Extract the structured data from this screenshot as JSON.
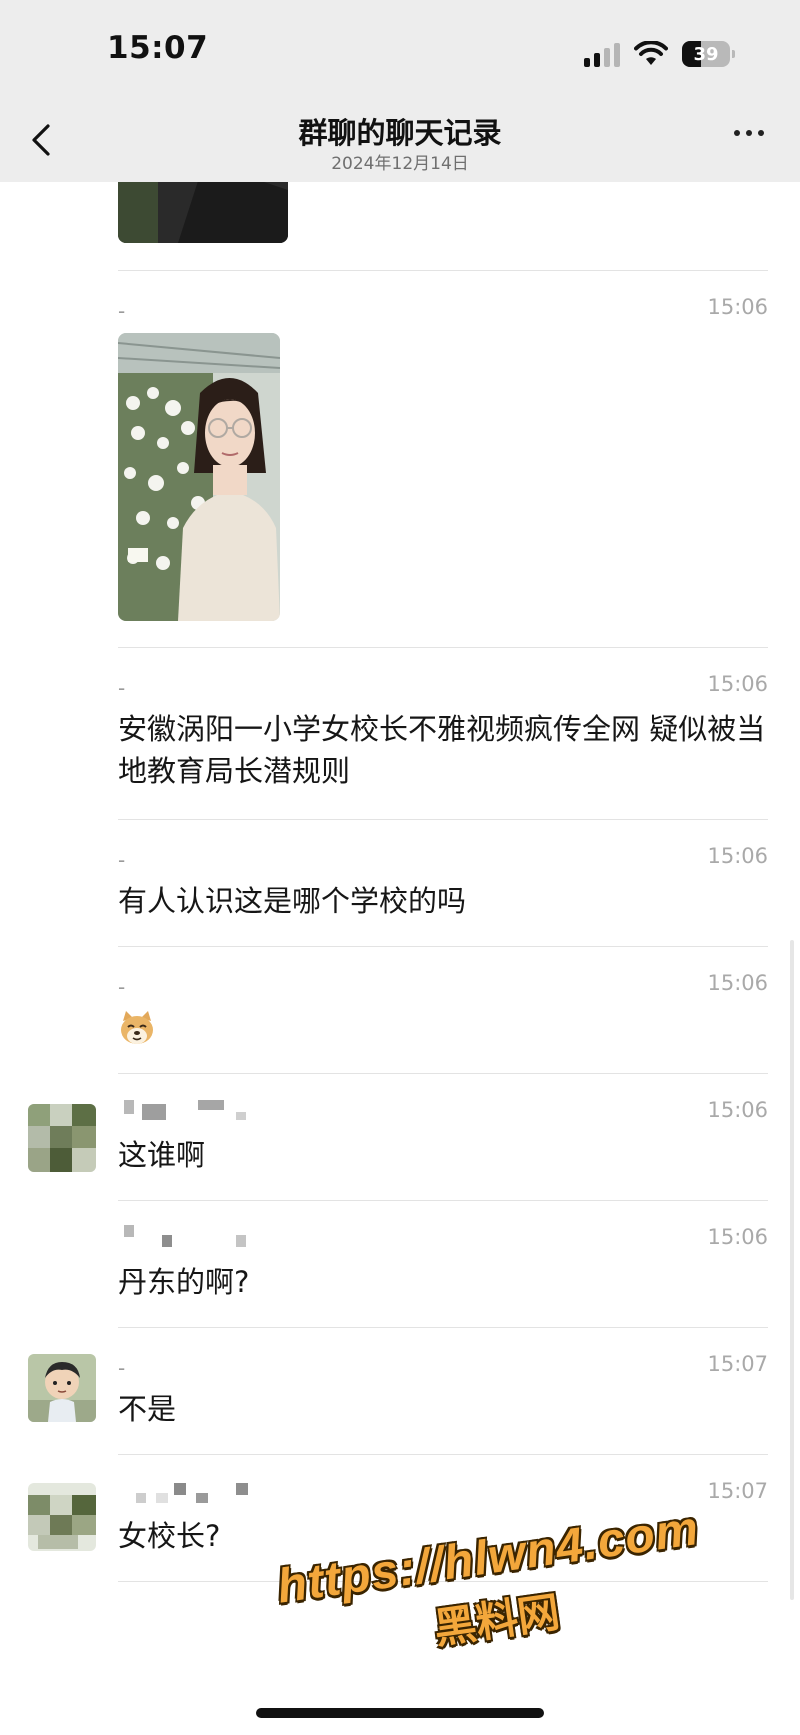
{
  "status_bar": {
    "time": "15:07",
    "battery": "39"
  },
  "header": {
    "title": "群聊的聊天记录",
    "subtitle": "2024年12月14日"
  },
  "messages": [
    {
      "sender": "-",
      "time": "15:06",
      "type": "image"
    },
    {
      "sender": "-",
      "time": "15:06",
      "type": "text",
      "text": "安徽涡阳一小学女校长不雅视频疯传全网 疑似被当地教育局长潜规则"
    },
    {
      "sender": "-",
      "time": "15:06",
      "type": "text",
      "text": "有人认识这是哪个学校的吗"
    },
    {
      "sender": "-",
      "time": "15:06",
      "type": "emoji",
      "emoji": "doge-emoji"
    },
    {
      "time": "15:06",
      "type": "text",
      "text": "这谁啊"
    },
    {
      "time": "15:06",
      "type": "text",
      "text": "丹东的啊?"
    },
    {
      "sender": "-",
      "time": "15:07",
      "type": "text",
      "text": "不是"
    },
    {
      "time": "15:07",
      "type": "text",
      "text": "女校长?"
    }
  ],
  "watermark": {
    "url": "https://hlwn4.com",
    "name": "黑料网"
  },
  "colors": {
    "header_bg": "#ededed",
    "watermark": "#f3a73b",
    "meta_text": "#a9a9a9"
  }
}
